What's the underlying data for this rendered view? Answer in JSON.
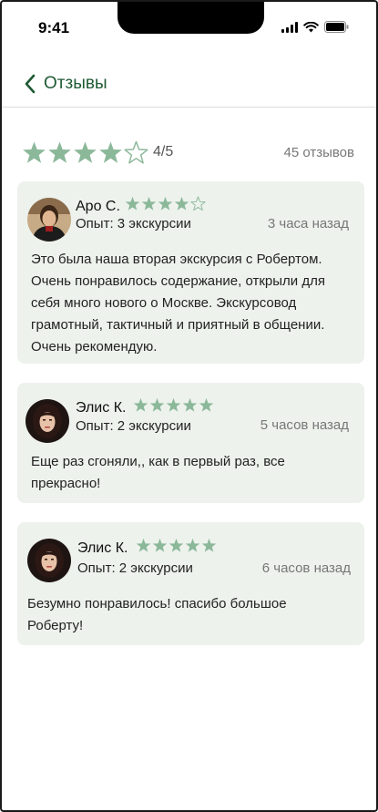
{
  "status_bar": {
    "time": "9:41"
  },
  "header": {
    "title": "Отзывы"
  },
  "summary": {
    "score_text": "4/5",
    "rating": 4,
    "max_rating": 5,
    "count_text": "45 отзывов"
  },
  "colors": {
    "accent": "#1f5a34",
    "star_filled": "#8cb89a",
    "card_bg": "#edf2ec"
  },
  "reviews": [
    {
      "name": "Аро С.",
      "rating": 4,
      "experience": "Опыт: 3 экскурсии",
      "time": "3 часа назад",
      "text": "Это была наша вторая экскурсия с Робертом. Очень понравилось содержание, открыли для себя много нового о Москве. Экскурсовод грамотный, тактичный и приятный в общении. Очень рекомендую."
    },
    {
      "name": "Элис К.",
      "rating": 5,
      "experience": "Опыт: 2 экскурсии",
      "time": "5 часов назад",
      "text": "Еще раз сгоняли,, как в первый раз, все прекрасно!"
    },
    {
      "name": "Элис К.",
      "rating": 5,
      "experience": "Опыт: 2 экскурсии",
      "time": "6 часов назад",
      "text": "Безумно понравилось! спасибо большое Роберту!"
    }
  ]
}
